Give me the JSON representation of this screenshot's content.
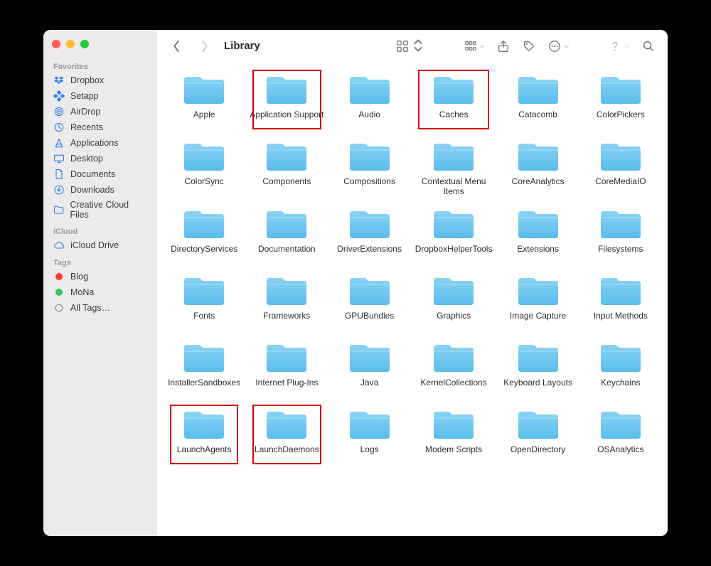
{
  "window": {
    "title": "Library"
  },
  "sidebar": {
    "sections": [
      {
        "label": "Favorites",
        "items": [
          {
            "icon": "dropbox-icon",
            "label": "Dropbox"
          },
          {
            "icon": "setapp-icon",
            "label": "Setapp"
          },
          {
            "icon": "airdrop-icon",
            "label": "AirDrop"
          },
          {
            "icon": "recents-icon",
            "label": "Recents"
          },
          {
            "icon": "applications-icon",
            "label": "Applications"
          },
          {
            "icon": "desktop-icon",
            "label": "Desktop"
          },
          {
            "icon": "documents-icon",
            "label": "Documents"
          },
          {
            "icon": "downloads-icon",
            "label": "Downloads"
          },
          {
            "icon": "folder-icon",
            "label": "Creative Cloud Files"
          }
        ]
      },
      {
        "label": "iCloud",
        "items": [
          {
            "icon": "cloud-icon",
            "label": "iCloud Drive"
          }
        ]
      },
      {
        "label": "Tags",
        "items": [
          {
            "icon": "tag-dot",
            "color": "#ff3b30",
            "label": "Blog"
          },
          {
            "icon": "tag-dot",
            "color": "#34c759",
            "label": "MoNa"
          },
          {
            "icon": "alltags-icon",
            "label": "All Tags…"
          }
        ]
      }
    ]
  },
  "folders": [
    {
      "name": "Apple",
      "highlighted": false
    },
    {
      "name": "Application Support",
      "highlighted": true
    },
    {
      "name": "Audio",
      "highlighted": false
    },
    {
      "name": "Caches",
      "highlighted": true
    },
    {
      "name": "Catacomb",
      "highlighted": false
    },
    {
      "name": "ColorPickers",
      "highlighted": false
    },
    {
      "name": "ColorSync",
      "highlighted": false
    },
    {
      "name": "Components",
      "highlighted": false
    },
    {
      "name": "Compositions",
      "highlighted": false
    },
    {
      "name": "Contextual Menu Items",
      "highlighted": false
    },
    {
      "name": "CoreAnalytics",
      "highlighted": false
    },
    {
      "name": "CoreMediaIO",
      "highlighted": false
    },
    {
      "name": "DirectoryServices",
      "highlighted": false
    },
    {
      "name": "Documentation",
      "highlighted": false
    },
    {
      "name": "DriverExtensions",
      "highlighted": false
    },
    {
      "name": "DropboxHelperTools",
      "highlighted": false
    },
    {
      "name": "Extensions",
      "highlighted": false
    },
    {
      "name": "Filesystems",
      "highlighted": false
    },
    {
      "name": "Fonts",
      "highlighted": false
    },
    {
      "name": "Frameworks",
      "highlighted": false
    },
    {
      "name": "GPUBundles",
      "highlighted": false
    },
    {
      "name": "Graphics",
      "highlighted": false
    },
    {
      "name": "Image Capture",
      "highlighted": false
    },
    {
      "name": "Input Methods",
      "highlighted": false
    },
    {
      "name": "InstallerSandboxes",
      "highlighted": false
    },
    {
      "name": "Internet Plug-Ins",
      "highlighted": false
    },
    {
      "name": "Java",
      "highlighted": false
    },
    {
      "name": "KernelCollections",
      "highlighted": false
    },
    {
      "name": "Keyboard Layouts",
      "highlighted": false
    },
    {
      "name": "Keychains",
      "highlighted": false
    },
    {
      "name": "LaunchAgents",
      "highlighted": true
    },
    {
      "name": "LaunchDaemons",
      "highlighted": true
    },
    {
      "name": "Logs",
      "highlighted": false
    },
    {
      "name": "Modem Scripts",
      "highlighted": false
    },
    {
      "name": "OpenDirectory",
      "highlighted": false
    },
    {
      "name": "OSAnalytics",
      "highlighted": false
    }
  ]
}
